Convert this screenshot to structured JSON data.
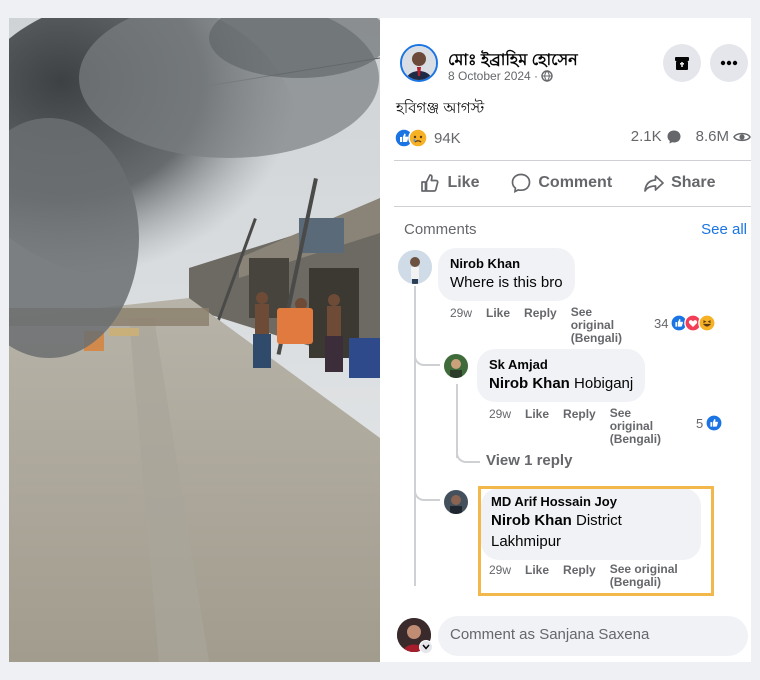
{
  "post": {
    "author": "মোঃ ইব্রাহিম হোসেন",
    "date": "8 October 2024 ·",
    "text": "হবিগঞ্জ আগস্ট",
    "reactions_count": "94K",
    "comments_count": "2.1K",
    "views_count": "8.6M"
  },
  "actions": {
    "like": "Like",
    "comment": "Comment",
    "share": "Share"
  },
  "comments_section": {
    "title": "Comments",
    "see_all": "See all"
  },
  "comments": [
    {
      "author": "Nirob Khan",
      "text": "Where is this bro",
      "time": "29w",
      "like": "Like",
      "reply": "Reply",
      "see_original": "See original (Bengali)",
      "reaction_count": "34"
    },
    {
      "author": "Sk Amjad",
      "mention": "Nirob Khan",
      "text": "Hobiganj",
      "time": "29w",
      "like": "Like",
      "reply": "Reply",
      "see_original": "See original (Bengali)",
      "reaction_count": "5"
    },
    {
      "author": "MD Arif Hossain Joy",
      "mention": "Nirob Khan",
      "text": "District Lakhmipur",
      "time": "29w",
      "like": "Like",
      "reply": "Reply",
      "see_original": "See original (Bengali)"
    }
  ],
  "view_reply": "View 1 reply",
  "composer": {
    "placeholder": "Comment as Sanjana Saxena"
  },
  "icons": {
    "reactions": [
      "like-reaction-icon",
      "sad-reaction-icon"
    ],
    "comment_reactions": [
      "like-reaction-icon",
      "love-reaction-icon",
      "haha-reaction-icon"
    ],
    "header_buttons": [
      "archive-icon",
      "more-options-icon"
    ]
  },
  "colors": {
    "brand_blue": "#1b74e4",
    "highlight": "#f2b84b",
    "bubble": "#f0f2f5"
  }
}
